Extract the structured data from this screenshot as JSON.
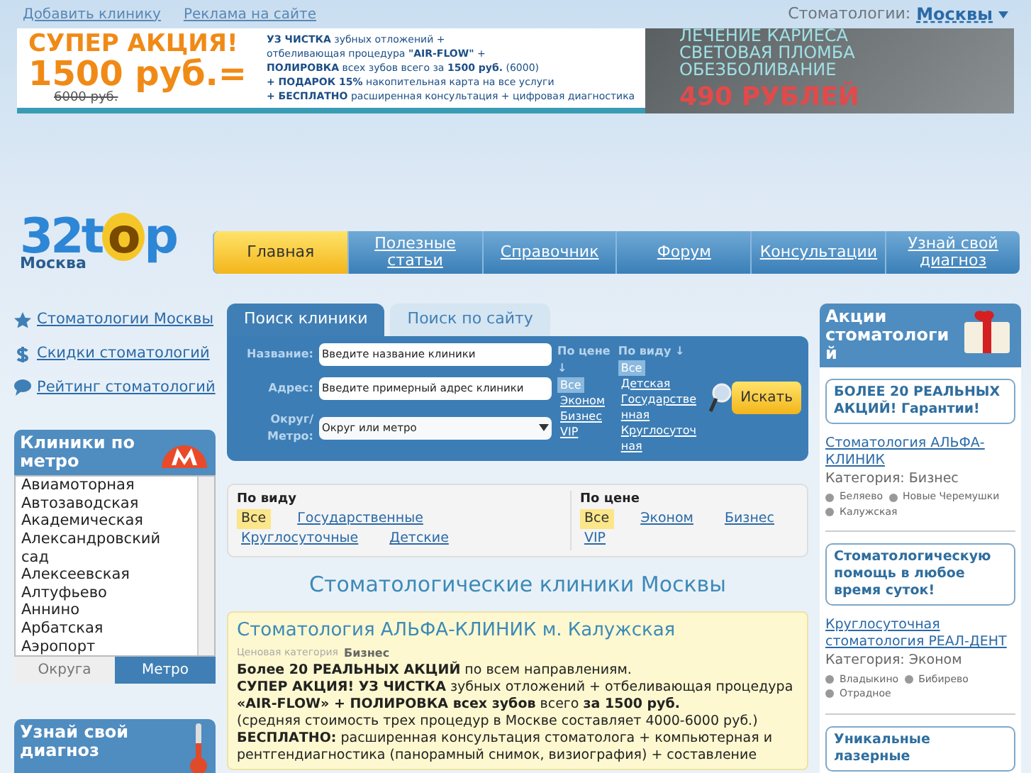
{
  "top_links": [
    {
      "label": "Добавить клинику"
    },
    {
      "label": "Реклама на сайте"
    }
  ],
  "city_selector": {
    "label": "Стоматологии:",
    "value": "Москвы"
  },
  "banner_left": {
    "headline": "СУПЕР АКЦИЯ!",
    "price": "1500 руб.=",
    "old_price": "6000 руб.",
    "lines": [
      "**УЗ ЧИСТКА** зубных отложений +",
      "отбеливающая процедура **\"AIR-FLOW\"** +",
      "**ПОЛИРОВКА** всех зубов всего за **1500 руб.** (6000)",
      "**+ ПОДАРОК 15%** накопительная карта на все услуги",
      "**+ БЕСПЛАТНО** расширенная консультация + цифровая диагностика"
    ]
  },
  "banner_right": {
    "lines": [
      "ЛЕЧЕНИЕ КАРИЕСА",
      "СВЕТОВАЯ ПЛОМБА",
      "ОБЕЗБОЛИВАНИЕ"
    ],
    "price": "490 РУБЛЕЙ"
  },
  "logo": {
    "text": "32top",
    "city": "Москва"
  },
  "nav": [
    {
      "label": "Главная",
      "selected": true
    },
    {
      "label": "Полезные статьи",
      "selected": false
    },
    {
      "label": "Справочник",
      "selected": false
    },
    {
      "label": "Форум",
      "selected": false
    },
    {
      "label": "Консультации",
      "selected": false
    },
    {
      "label": "Узнай свой диагноз",
      "selected": false
    }
  ],
  "side_links": [
    {
      "kind": "star",
      "label": "Стоматологии Москвы"
    },
    {
      "kind": "dollar",
      "label": "Скидки стоматологий"
    },
    {
      "kind": "chat",
      "label": "Рейтинг стоматологий"
    }
  ],
  "metro_panel": {
    "title": "Клиники по метро",
    "stations": [
      "Авиамоторная",
      "Автозаводская",
      "Академическая",
      "Александровский сад",
      "Алексеевская",
      "Алтуфьево",
      "Аннино",
      "Арбатская",
      "Аэропорт"
    ],
    "tabs": [
      {
        "label": "Округа",
        "selected": false
      },
      {
        "label": "Метро",
        "selected": true
      }
    ]
  },
  "diagnosis_panel": {
    "title": "Узнай свой диагноз"
  },
  "search": {
    "tabs": [
      {
        "label": "Поиск клиники",
        "selected": true
      },
      {
        "label": "Поиск по сайту",
        "selected": false
      }
    ],
    "fields": [
      {
        "label": "Название:",
        "value": "Введите название клиники"
      },
      {
        "label": "Адрес:",
        "value": "Введите примерный адрес клиники"
      }
    ],
    "district": {
      "label": "Округ/Метро:",
      "value": "Округ или метро"
    },
    "price_filter": {
      "title": "По цене ↓",
      "options": [
        {
          "label": "Все",
          "selected": true
        },
        {
          "label": "Эконом",
          "selected": false
        },
        {
          "label": "Бизнес",
          "selected": false
        },
        {
          "label": "VIP",
          "selected": false
        }
      ]
    },
    "type_filter": {
      "title": "По виду ↓",
      "options": [
        {
          "label": "Все",
          "selected": true
        },
        {
          "label": "Детская",
          "selected": false
        },
        {
          "label": "Государственная",
          "selected": false
        },
        {
          "label": "Круглосуточная",
          "selected": false
        }
      ]
    },
    "button": "Искать"
  },
  "filters": [
    {
      "title": "По виду",
      "options": [
        {
          "label": "Все",
          "selected": true
        },
        {
          "label": "Государственные",
          "selected": false
        },
        {
          "label": "Круглосуточные",
          "selected": false
        },
        {
          "label": "Детские",
          "selected": false
        }
      ]
    },
    {
      "title": "По цене",
      "options": [
        {
          "label": "Все",
          "selected": true
        },
        {
          "label": "Эконом",
          "selected": false
        },
        {
          "label": "Бизнес",
          "selected": false
        },
        {
          "label": "VIP",
          "selected": false
        }
      ]
    }
  ],
  "heading": "Стоматологические клиники Москвы",
  "clinic": {
    "title": "Стоматология АЛЬФА-КЛИНИК м. Калужская",
    "category_label": "Ценовая категория",
    "category": "Бизнес",
    "text": [
      "**Более 20 РЕАЛЬНЫХ АКЦИЙ** по всем направлениям.",
      "**СУПЕР АКЦИЯ! УЗ ЧИСТКА** зубных отложений + отбеливающая процедура **«AIR-FLOW» + ПОЛИРОВКА всех зубов** всего **за 1500 руб.**",
      "(средняя стоимость трех процедур в Москве составляет 4000-6000 руб.)",
      "**БЕСПЛАТНО:** расширенная консультация стоматолога + компьютерная и рентгендиагностика (панорамный снимок, визиография) + составление"
    ]
  },
  "promo_panel": {
    "title": "Акции стоматологий",
    "items": [
      {
        "bubble": "БОЛЕЕ 20 РЕАЛЬНЫХ АКЦИЙ! Гарантии!",
        "clinic": "Стоматология АЛЬФА-КЛИНИК",
        "category": "Категория: Бизнес",
        "stations": [
          "Беляево",
          "Новые Черемушки",
          "Калужская"
        ]
      },
      {
        "bubble": "Стоматологическую помощь в любое время суток!",
        "clinic": "Круглосуточная стоматология РЕАЛ-ДЕНТ",
        "category": "Категория: Эконом",
        "stations": [
          "Владыкино",
          "Бибирево",
          "Отрадное"
        ]
      },
      {
        "bubble": "Уникальные лазерные"
      }
    ]
  }
}
